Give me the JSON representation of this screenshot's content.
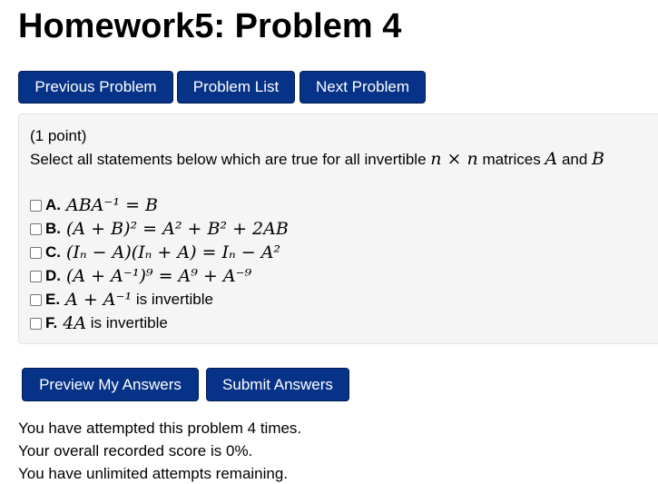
{
  "page": {
    "title": "Homework5: Problem 4"
  },
  "nav": {
    "previous_label": "Previous Problem",
    "list_label": "Problem List",
    "next_label": "Next Problem"
  },
  "problem": {
    "points": "(1 point)",
    "statement_prefix": "Select all statements below which are true for all invertible",
    "statement_dim": "n × n",
    "statement_middle": "matrices",
    "statement_a": "A",
    "statement_and": "and",
    "statement_b": "B",
    "options": [
      {
        "label": "A.",
        "formula": "ABA⁻¹ = B",
        "text": ""
      },
      {
        "label": "B.",
        "formula": "(A + B)² = A² + B² + 2AB",
        "text": ""
      },
      {
        "label": "C.",
        "formula": "(Iₙ − A)(Iₙ + A) = Iₙ − A²",
        "text": ""
      },
      {
        "label": "D.",
        "formula": "(A + A⁻¹)⁹ = A⁹ + A⁻⁹",
        "text": ""
      },
      {
        "label": "E.",
        "formula": "A + A⁻¹",
        "text": "is invertible"
      },
      {
        "label": "F.",
        "formula": "4A",
        "text": "is invertible"
      }
    ]
  },
  "actions": {
    "preview_label": "Preview My Answers",
    "submit_label": "Submit Answers"
  },
  "status": {
    "attempts": "You have attempted this problem 4 times.",
    "score": "Your overall recorded score is 0%.",
    "remaining": "You have unlimited attempts remaining."
  },
  "colors": {
    "button_bg": "#063387",
    "button_text": "#ffffff",
    "panel_bg": "#f5f5f5"
  }
}
